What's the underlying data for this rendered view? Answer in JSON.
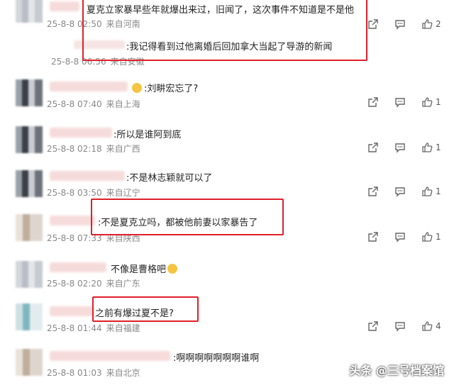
{
  "comments": [
    {
      "text": "夏克立家暴早些年就爆出来过，旧闻了，这次事件不知道是不是他",
      "date": "25-8-8 02:50",
      "location": "来自河南",
      "likes": "2",
      "reply_text": ":我记得看到过他离婚后回加拿大当起了导游的新闻",
      "reply_date": "25-8-8 06:56",
      "reply_location": "来自安徽"
    },
    {
      "text": ":刘畊宏忘了?",
      "date": "25-8-8 07:40",
      "location": "来自上海",
      "likes": "1"
    },
    {
      "text": ":所以是谁阿到底",
      "date": "25-8-8 02:18",
      "location": "来自广西",
      "likes": "1"
    },
    {
      "text": ":不是林志颖就可以了",
      "date": "25-8-8 03:50",
      "location": "来自辽宁",
      "likes": "1"
    },
    {
      "text": ":不是夏克立吗，都被他前妻以家暴告了",
      "date": "25-8-8 07:33",
      "location": "来自陕西",
      "likes": "1"
    },
    {
      "text": "不像是曹格吧",
      "date": "25-8-8 02:20",
      "location": "来自广东",
      "likes": ""
    },
    {
      "text": "之前有爆过夏不是?",
      "date": "25-8-8 01:44",
      "location": "来自福建",
      "likes": "4"
    },
    {
      "text": ":啊啊啊啊啊啊啊谁啊",
      "date": "25-8-8 01:03",
      "location": "来自北京",
      "likes": "1"
    }
  ],
  "watermark": "头条 @三号档案馆",
  "colors": {
    "highlight": "#e0202a",
    "meta": "#888888"
  }
}
